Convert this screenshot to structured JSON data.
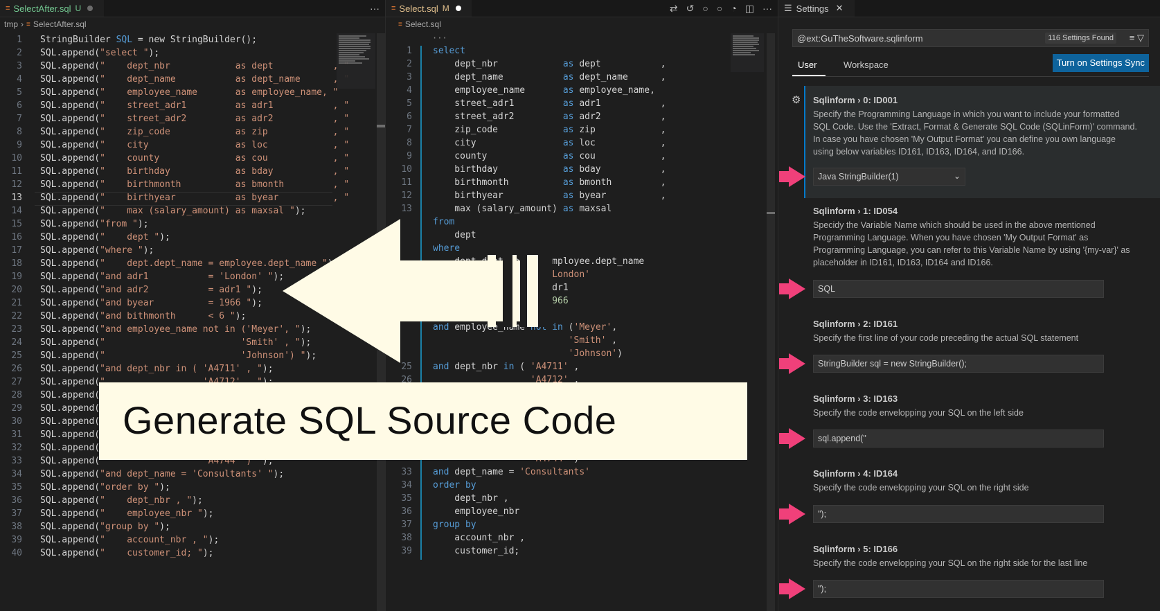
{
  "left": {
    "tab": {
      "label": "SelectAfter.sql",
      "status": "U"
    },
    "breadcrumb": [
      "tmp",
      "SelectAfter.sql"
    ],
    "more_label": "···",
    "active_line": 13,
    "lines": [
      [
        [
          "t",
          "StringBuilder "
        ],
        [
          "k",
          "SQL"
        ],
        [
          "t",
          " = new StringBuilder();"
        ]
      ],
      [
        [
          "t",
          "SQL.append("
        ],
        [
          "s",
          "\"select \""
        ],
        [
          "t",
          ");"
        ]
      ],
      [
        [
          "t",
          "SQL.append("
        ],
        [
          "s",
          "\"    dept_nbr            as dept           , \""
        ]
      ],
      [
        [
          "t",
          "SQL.append("
        ],
        [
          "s",
          "\"    dept_name           as dept_name      , \""
        ]
      ],
      [
        [
          "t",
          "SQL.append("
        ],
        [
          "s",
          "\"    employee_name       as employee_name, \""
        ]
      ],
      [
        [
          "t",
          "SQL.append("
        ],
        [
          "s",
          "\"    street_adr1         as adr1           , \""
        ]
      ],
      [
        [
          "t",
          "SQL.append("
        ],
        [
          "s",
          "\"    street_adr2         as adr2           , \""
        ]
      ],
      [
        [
          "t",
          "SQL.append("
        ],
        [
          "s",
          "\"    zip_code            as zip            , \""
        ]
      ],
      [
        [
          "t",
          "SQL.append("
        ],
        [
          "s",
          "\"    city                as loc            , \""
        ]
      ],
      [
        [
          "t",
          "SQL.append("
        ],
        [
          "s",
          "\"    county              as cou            , \""
        ]
      ],
      [
        [
          "t",
          "SQL.append("
        ],
        [
          "s",
          "\"    birthday            as bday           , \""
        ]
      ],
      [
        [
          "t",
          "SQL.append("
        ],
        [
          "s",
          "\"    birthmonth          as bmonth         , \""
        ]
      ],
      [
        [
          "t",
          "SQL.append("
        ],
        [
          "s",
          "\"    birthyear           as byear          , \""
        ]
      ],
      [
        [
          "t",
          "SQL.append("
        ],
        [
          "s",
          "\"    max (salary_amount) as maxsal \""
        ],
        [
          "t",
          ");"
        ]
      ],
      [
        [
          "t",
          "SQL.append("
        ],
        [
          "s",
          "\"from \""
        ],
        [
          "t",
          ");"
        ]
      ],
      [
        [
          "t",
          "SQL.append("
        ],
        [
          "s",
          "\"    dept \""
        ],
        [
          "t",
          ");"
        ]
      ],
      [
        [
          "t",
          "SQL.append("
        ],
        [
          "s",
          "\"where \""
        ],
        [
          "t",
          ");"
        ]
      ],
      [
        [
          "t",
          "SQL.append("
        ],
        [
          "s",
          "\"    dept.dept_name = employee.dept_name \""
        ],
        [
          "t",
          ");"
        ]
      ],
      [
        [
          "t",
          "SQL.append("
        ],
        [
          "s",
          "\"and adr1           = 'London' \""
        ],
        [
          "t",
          ");"
        ]
      ],
      [
        [
          "t",
          "SQL.append("
        ],
        [
          "s",
          "\"and adr2           = adr1 \""
        ],
        [
          "t",
          ");"
        ]
      ],
      [
        [
          "t",
          "SQL.append("
        ],
        [
          "s",
          "\"and byear          = 1966 \""
        ],
        [
          "t",
          ");"
        ]
      ],
      [
        [
          "t",
          "SQL.append("
        ],
        [
          "s",
          "\"and bithmonth      < 6 \""
        ],
        [
          "t",
          ");"
        ]
      ],
      [
        [
          "t",
          "SQL.append("
        ],
        [
          "s",
          "\"and employee_name not in ('Meyer', \""
        ],
        [
          "t",
          ");"
        ]
      ],
      [
        [
          "t",
          "SQL.append("
        ],
        [
          "s",
          "\"                         'Smith' , \""
        ],
        [
          "t",
          ");"
        ]
      ],
      [
        [
          "t",
          "SQL.append("
        ],
        [
          "s",
          "\"                         'Johnson') \""
        ],
        [
          "t",
          ");"
        ]
      ],
      [
        [
          "t",
          "SQL.append("
        ],
        [
          "s",
          "\"and dept_nbr in ( 'A4711' , \""
        ],
        [
          "t",
          ");"
        ]
      ],
      [
        [
          "t",
          "SQL.append("
        ],
        [
          "s",
          "\"                  'A4712' , \""
        ],
        [
          "t",
          ");"
        ]
      ],
      [
        [
          "t",
          "SQL.append("
        ],
        [
          "s",
          "\""
        ]
      ],
      [
        [
          "t",
          "SQL.append("
        ],
        [
          "s",
          "\""
        ]
      ],
      [
        [
          "t",
          "SQL.append("
        ],
        [
          "s",
          "\""
        ]
      ],
      [
        [
          "t",
          "SQL.append("
        ],
        [
          "s",
          "\""
        ]
      ],
      [
        [
          "t",
          "SQL.append("
        ],
        [
          "s",
          "\""
        ]
      ],
      [
        [
          "t",
          "SQL.append("
        ],
        [
          "s",
          "\"                  'A4744' ) \""
        ],
        [
          "t",
          ");"
        ]
      ],
      [
        [
          "t",
          "SQL.append("
        ],
        [
          "s",
          "\"and dept_name = 'Consultants' \""
        ],
        [
          "t",
          ");"
        ]
      ],
      [
        [
          "t",
          "SQL.append("
        ],
        [
          "s",
          "\"order by \""
        ],
        [
          "t",
          ");"
        ]
      ],
      [
        [
          "t",
          "SQL.append("
        ],
        [
          "s",
          "\"    dept_nbr , \""
        ],
        [
          "t",
          ");"
        ]
      ],
      [
        [
          "t",
          "SQL.append("
        ],
        [
          "s",
          "\"    employee_nbr \""
        ],
        [
          "t",
          ");"
        ]
      ],
      [
        [
          "t",
          "SQL.append("
        ],
        [
          "s",
          "\"group by \""
        ],
        [
          "t",
          ");"
        ]
      ],
      [
        [
          "t",
          "SQL.append("
        ],
        [
          "s",
          "\"    account_nbr , \""
        ],
        [
          "t",
          ");"
        ]
      ],
      [
        [
          "t",
          "SQL.append("
        ],
        [
          "s",
          "\"    customer_id; \""
        ],
        [
          "t",
          ");"
        ]
      ]
    ]
  },
  "middle": {
    "tab": {
      "label": "Select.sql",
      "status": "M"
    },
    "breadcrumb": [
      "Select.sql"
    ],
    "more_label": "···",
    "lines": [
      {
        "n": 1,
        "segs": [
          [
            "k",
            "select"
          ]
        ]
      },
      {
        "n": 2,
        "segs": [
          [
            "t",
            "    dept_nbr            "
          ],
          [
            "k",
            "as"
          ],
          [
            "t",
            " dept           ,"
          ]
        ]
      },
      {
        "n": 3,
        "segs": [
          [
            "t",
            "    dept_name           "
          ],
          [
            "k",
            "as"
          ],
          [
            "t",
            " dept_name      ,"
          ]
        ]
      },
      {
        "n": 4,
        "segs": [
          [
            "t",
            "    employee_name       "
          ],
          [
            "k",
            "as"
          ],
          [
            "t",
            " employee_name,"
          ]
        ]
      },
      {
        "n": 5,
        "segs": [
          [
            "t",
            "    street_adr1         "
          ],
          [
            "k",
            "as"
          ],
          [
            "t",
            " adr1           ,"
          ]
        ]
      },
      {
        "n": 6,
        "segs": [
          [
            "t",
            "    street_adr2         "
          ],
          [
            "k",
            "as"
          ],
          [
            "t",
            " adr2           ,"
          ]
        ]
      },
      {
        "n": 7,
        "segs": [
          [
            "t",
            "    zip_code            "
          ],
          [
            "k",
            "as"
          ],
          [
            "t",
            " zip            ,"
          ]
        ]
      },
      {
        "n": 8,
        "segs": [
          [
            "t",
            "    city                "
          ],
          [
            "k",
            "as"
          ],
          [
            "t",
            " loc            ,"
          ]
        ]
      },
      {
        "n": 9,
        "segs": [
          [
            "t",
            "    county              "
          ],
          [
            "k",
            "as"
          ],
          [
            "t",
            " cou            ,"
          ]
        ]
      },
      {
        "n": 10,
        "segs": [
          [
            "t",
            "    birthday            "
          ],
          [
            "k",
            "as"
          ],
          [
            "t",
            " bday           ,"
          ]
        ]
      },
      {
        "n": 11,
        "segs": [
          [
            "t",
            "    birthmonth          "
          ],
          [
            "k",
            "as"
          ],
          [
            "t",
            " bmonth         ,"
          ]
        ]
      },
      {
        "n": 12,
        "segs": [
          [
            "t",
            "    birthyear           "
          ],
          [
            "k",
            "as"
          ],
          [
            "t",
            " byear          ,"
          ]
        ]
      },
      {
        "n": 13,
        "segs": [
          [
            "t",
            "    max (salary_amount) "
          ],
          [
            "k",
            "as"
          ],
          [
            "t",
            " maxsal"
          ]
        ]
      },
      {
        "n": "",
        "segs": [
          [
            "k",
            "from"
          ]
        ]
      },
      {
        "n": "",
        "segs": [
          [
            "t",
            "    dept"
          ]
        ]
      },
      {
        "n": "",
        "segs": [
          [
            "k",
            "where"
          ]
        ]
      },
      {
        "n": "",
        "segs": [
          [
            "t",
            "    dept.dept_name = employee.dept_name"
          ]
        ]
      },
      {
        "n": "",
        "segs": [
          [
            "t",
            "                   = "
          ],
          [
            "s",
            "'London'"
          ]
        ]
      },
      {
        "n": "",
        "segs": [
          [
            "t",
            "                   = adr1"
          ]
        ]
      },
      {
        "n": "",
        "segs": [
          [
            "t",
            "                   = "
          ],
          [
            "n",
            "1966"
          ]
        ]
      },
      {
        "n": "",
        "segs": [
          [
            "t",
            "and bithmont      < "
          ],
          [
            "n",
            "6"
          ]
        ]
      },
      {
        "n": "",
        "segs": [
          [
            "k",
            "and"
          ],
          [
            "t",
            " employee_name "
          ],
          [
            "k",
            "not in"
          ],
          [
            "t",
            " ("
          ],
          [
            "s",
            "'Meyer'"
          ],
          [
            "t",
            ","
          ]
        ]
      },
      {
        "n": "",
        "segs": [
          [
            "t",
            "                         "
          ],
          [
            "s",
            "'Smith'"
          ],
          [
            "t",
            " ,"
          ]
        ]
      },
      {
        "n": "",
        "segs": [
          [
            "t",
            "                         "
          ],
          [
            "s",
            "'Johnson'"
          ],
          [
            "t",
            ")"
          ]
        ]
      },
      {
        "n": 25,
        "segs": [
          [
            "k",
            "and"
          ],
          [
            "t",
            " dept_nbr "
          ],
          [
            "k",
            "in"
          ],
          [
            "t",
            " ( "
          ],
          [
            "s",
            "'A4711'"
          ],
          [
            "t",
            " ,"
          ]
        ]
      },
      {
        "n": 26,
        "segs": [
          [
            "t",
            "                  "
          ],
          [
            "s",
            "'A4712'"
          ],
          [
            "t",
            " ,"
          ]
        ]
      },
      {
        "n": "",
        "segs": []
      },
      {
        "n": "",
        "segs": []
      },
      {
        "n": "",
        "segs": []
      },
      {
        "n": "",
        "segs": []
      },
      {
        "n": "",
        "segs": []
      },
      {
        "n": "",
        "segs": [
          [
            "t",
            "                  "
          ],
          [
            "s",
            "'A4744'"
          ],
          [
            "t",
            " )"
          ]
        ]
      },
      {
        "n": 33,
        "segs": [
          [
            "k",
            "and"
          ],
          [
            "t",
            " dept_name = "
          ],
          [
            "s",
            "'Consultants'"
          ]
        ]
      },
      {
        "n": 34,
        "segs": [
          [
            "k",
            "order by"
          ]
        ]
      },
      {
        "n": 35,
        "segs": [
          [
            "t",
            "    dept_nbr ,"
          ]
        ]
      },
      {
        "n": 36,
        "segs": [
          [
            "t",
            "    employee_nbr"
          ]
        ]
      },
      {
        "n": 37,
        "segs": [
          [
            "k",
            "group by"
          ]
        ]
      },
      {
        "n": 38,
        "segs": [
          [
            "t",
            "    account_nbr ,"
          ]
        ]
      },
      {
        "n": 39,
        "segs": [
          [
            "t",
            "    customer_id;"
          ]
        ]
      }
    ]
  },
  "settings": {
    "tab_label": "Settings",
    "search_value": "@ext:GuTheSoftware.sqlinform",
    "found_label": "116 Settings Found",
    "tabs": [
      "User",
      "Workspace"
    ],
    "sync_button": "Turn on Settings Sync",
    "items": [
      {
        "prefix": "Sqlinform › 0: ",
        "id": "ID001",
        "desc": "Specify the Programming Language in which you want to include your formatted SQL Code. Use the 'Extract, Format & Generate SQL Code (SQLinForm)' command. In case you have chosen 'My Output Format' you can define you own language using below variables ID161, ID163, ID164, and ID166.",
        "value": "Java StringBuilder(1)"
      },
      {
        "prefix": "Sqlinform › 1: ",
        "id": "ID054",
        "desc": "Specidy the Variable Name which should be used in the above mentioned Programming Language. When you have chosen 'My Output Format' as Programming Language, you can refer to this Variable Name by using '{my-var}' as placeholder in ID161, ID163, ID164 and ID166.",
        "value": "SQL"
      },
      {
        "prefix": "Sqlinform › 2: ",
        "id": "ID161",
        "desc": "Specify the first line of your code preceding the actual SQL statement",
        "value": "StringBuilder sql = new StringBuilder();"
      },
      {
        "prefix": "Sqlinform › 3: ",
        "id": "ID163",
        "desc": "Specify the code envelopping your SQL on the left side",
        "value": "sql.append(\""
      },
      {
        "prefix": "Sqlinform › 4: ",
        "id": "ID164",
        "desc": "Specify the code envelopping your SQL on the right side",
        "value": "\");"
      },
      {
        "prefix": "Sqlinform › 5: ",
        "id": "ID166",
        "desc": "Specify the code envelopping your SQL on the right side for the last line",
        "value": "\");"
      }
    ]
  },
  "overlay": {
    "banner_text": "Generate SQL Source Code"
  },
  "colors": {
    "keyword": "#569cd6",
    "string": "#ce9178",
    "number": "#b5cea8",
    "accent_pink": "#f0407a",
    "banner_bg": "#fffbe6",
    "sync_button": "#0e639c"
  }
}
